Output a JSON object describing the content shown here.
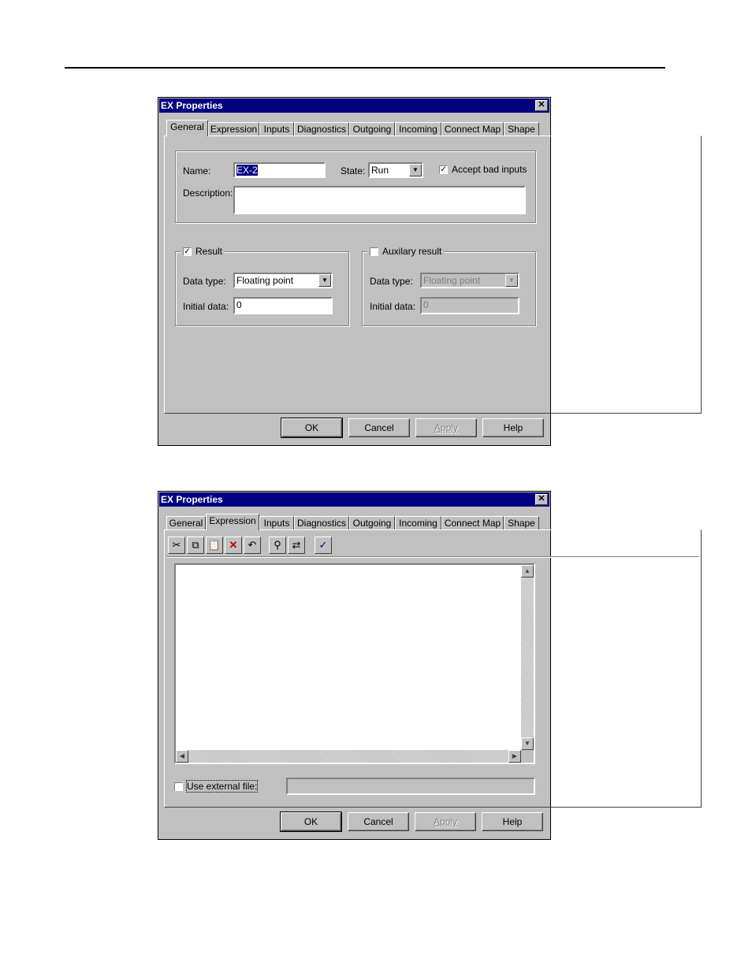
{
  "dialog1": {
    "title": "EX Properties",
    "tabs": [
      "General",
      "Expression",
      "Inputs",
      "Diagnostics",
      "Outgoing",
      "Incoming",
      "Connect Map",
      "Shape"
    ],
    "active_tab": "General",
    "name_label": "Name:",
    "name_value": "EX-2",
    "state_label": "State:",
    "state_value": "Run",
    "accept_bad_inputs_label": "Accept bad inputs",
    "accept_bad_inputs_checked": true,
    "description_label": "Description:",
    "description_value": "",
    "result": {
      "label": "Result",
      "checked": true,
      "data_type_label": "Data type:",
      "data_type_value": "Floating point",
      "initial_data_label": "Initial data:",
      "initial_data_value": "0"
    },
    "aux_result": {
      "label": "Auxilary result",
      "checked": false,
      "data_type_label": "Data type:",
      "data_type_value": "Floating point",
      "initial_data_label": "Initial data:",
      "initial_data_value": "0"
    },
    "buttons": {
      "ok": "OK",
      "cancel": "Cancel",
      "apply": "Apply",
      "help": "Help"
    }
  },
  "dialog2": {
    "title": "EX Properties",
    "tabs": [
      "General",
      "Expression",
      "Inputs",
      "Diagnostics",
      "Outgoing",
      "Incoming",
      "Connect Map",
      "Shape"
    ],
    "active_tab": "Expression",
    "toolbar_icons": [
      "cut-icon",
      "copy-icon",
      "paste-icon",
      "delete-icon",
      "undo-icon",
      "find-icon",
      "replace-icon",
      "check-icon"
    ],
    "use_external_file_label": "Use external file:",
    "use_external_file_checked": false,
    "external_file_value": "",
    "buttons": {
      "ok": "OK",
      "cancel": "Cancel",
      "apply": "Apply",
      "help": "Help"
    }
  }
}
